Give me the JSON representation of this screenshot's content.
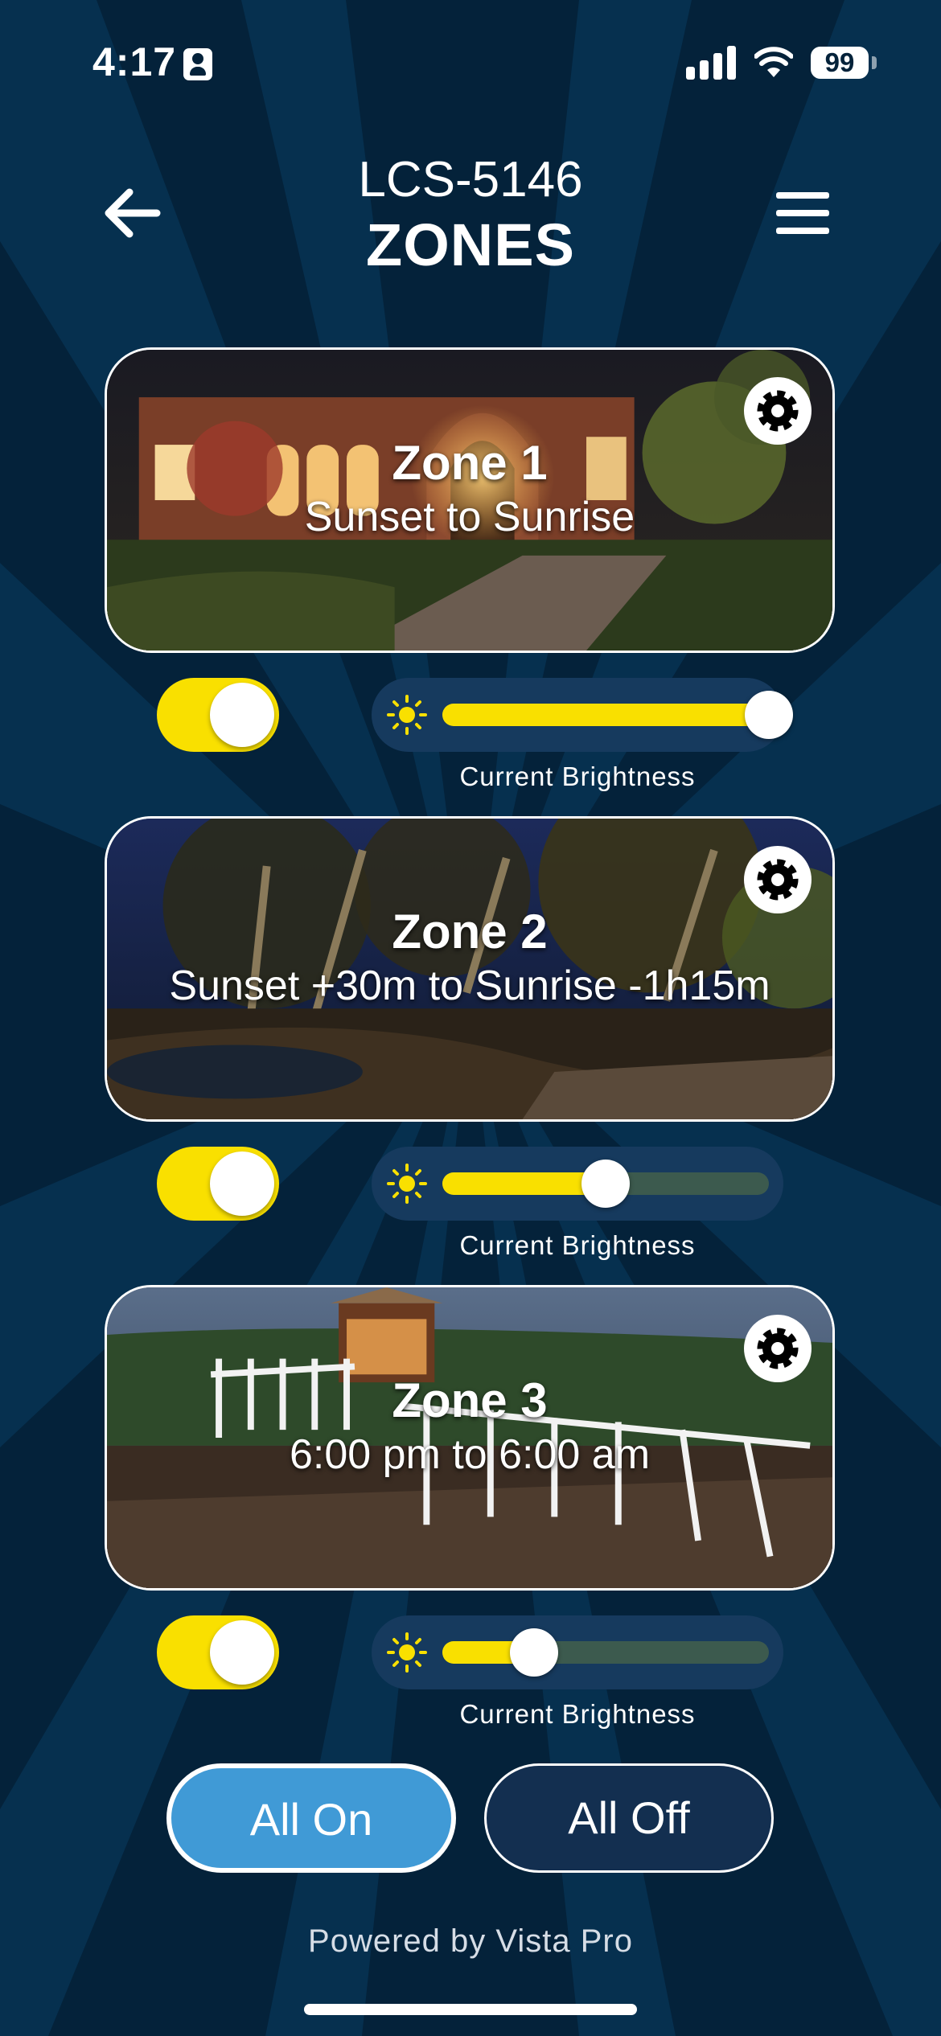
{
  "status_bar": {
    "time": "4:17",
    "battery": "99"
  },
  "header": {
    "subtitle": "LCS-5146",
    "title": "ZONES"
  },
  "icons": {
    "back": "arrow-left-icon",
    "menu": "hamburger-menu-icon",
    "settings": "gear-icon",
    "brightness": "sun-icon",
    "signal": "cellular-signal-icon",
    "wifi": "wifi-icon",
    "battery": "battery-icon",
    "contact": "contact-card-icon"
  },
  "colors": {
    "accent": "#f9e000",
    "background": "#04223a",
    "all_on": "#409ad6",
    "all_off": "#132f50"
  },
  "zones": [
    {
      "name": "Zone 1",
      "schedule": "Sunset to Sunrise",
      "on": true,
      "brightness_percent": 100,
      "brightness_label": "Current Brightness"
    },
    {
      "name": "Zone 2",
      "schedule": "Sunset +30m to Sunrise -1h15m",
      "on": true,
      "brightness_percent": 50,
      "brightness_label": "Current Brightness"
    },
    {
      "name": "Zone 3",
      "schedule": "6:00 pm to 6:00 am",
      "on": true,
      "brightness_percent": 28,
      "brightness_label": "Current Brightness"
    }
  ],
  "buttons": {
    "all_on": "All On",
    "all_off": "All Off"
  },
  "footer": {
    "powered_by": "Powered by Vista Pro"
  }
}
